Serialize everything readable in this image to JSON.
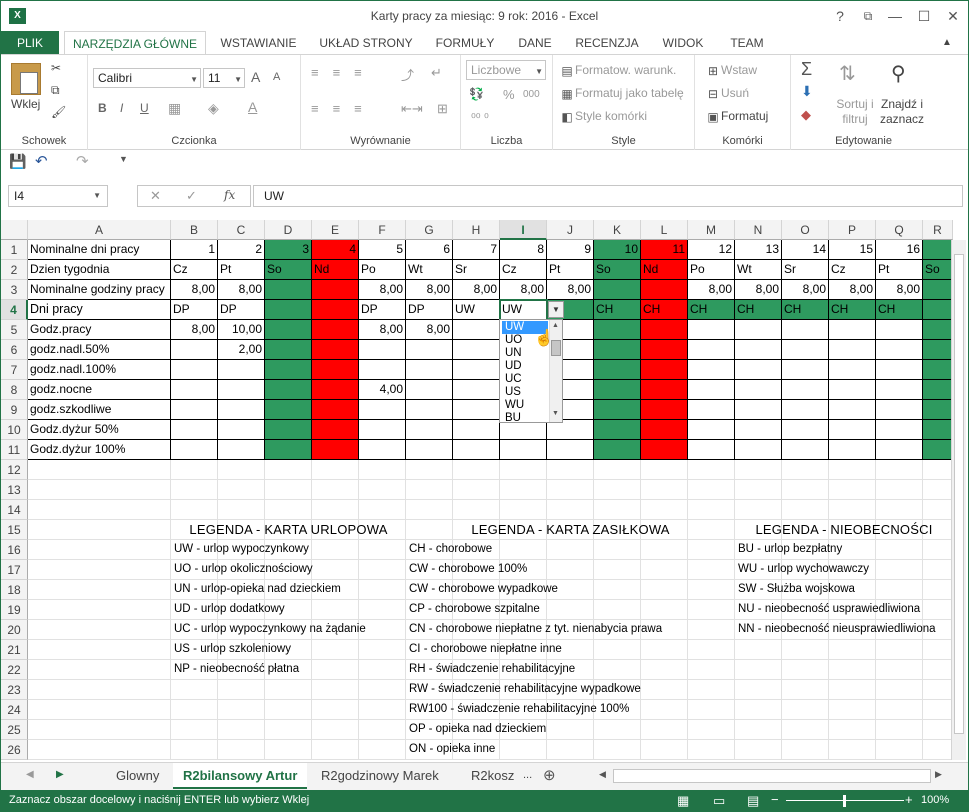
{
  "window": {
    "title": "Karty pracy za miesiąc: 9 rok: 2016 - Excel",
    "help": "?",
    "restore": "⧉",
    "minimize": "—",
    "maximize": "☐",
    "close": "✕"
  },
  "tabs": [
    "PLIK",
    "NARZĘDZIA GŁÓWNE",
    "WSTAWIANIE",
    "UKŁAD STRONY",
    "FORMUŁY",
    "DANE",
    "RECENZJA",
    "WIDOK",
    "TEAM"
  ],
  "ribbon": {
    "clipboard": {
      "label": "Schowek",
      "paste": "Wklej"
    },
    "font": {
      "label": "Czcionka",
      "name": "Calibri",
      "size": "11",
      "bold": "B",
      "italic": "I",
      "underline": "U",
      "grow": "A",
      "shrink": "A"
    },
    "alignment": {
      "label": "Wyrównanie"
    },
    "number": {
      "label": "Liczba",
      "format": "Liczbowe",
      "percent": "%",
      "comma": "000"
    },
    "styles": {
      "label": "Style",
      "conditional": "Formatow. warunk.",
      "table": "Formatuj jako tabelę",
      "cell_styles": "Style komórki"
    },
    "cells": {
      "label": "Komórki",
      "insert": "Wstaw",
      "delete": "Usuń",
      "format": "Formatuj"
    },
    "editing": {
      "label": "Edytowanie",
      "sort": "Sortuj i filtruj",
      "find": "Znajdź i zaznacz"
    }
  },
  "formula_bar": {
    "name_box": "I4",
    "fx": "fx",
    "value": "UW"
  },
  "columns": [
    "A",
    "B",
    "C",
    "D",
    "E",
    "F",
    "G",
    "H",
    "I",
    "J",
    "K",
    "L",
    "M",
    "N",
    "O",
    "P",
    "Q",
    "R"
  ],
  "rows": [
    "1",
    "2",
    "3",
    "4",
    "5",
    "6",
    "7",
    "8",
    "9",
    "10",
    "11",
    "12",
    "13",
    "14",
    "15",
    "16",
    "17",
    "18",
    "19",
    "20",
    "21",
    "22",
    "23",
    "24",
    "25",
    "26"
  ],
  "sheet": {
    "row1": {
      "label": "Nominalne dni pracy",
      "days": [
        "1",
        "2",
        "3",
        "4",
        "5",
        "6",
        "7",
        "8",
        "9",
        "10",
        "11",
        "12",
        "13",
        "14",
        "15",
        "16"
      ]
    },
    "row2": {
      "label": "Dzien tygodnia",
      "days": [
        "Cz",
        "Pt",
        "So",
        "Nd",
        "Po",
        "Wt",
        "Sr",
        "Cz",
        "Pt",
        "So",
        "Nd",
        "Po",
        "Wt",
        "Sr",
        "Cz",
        "Pt",
        "So"
      ]
    },
    "row3": {
      "label": "Nominalne godziny pracy",
      "hours": [
        "8,00",
        "8,00",
        "",
        "",
        "8,00",
        "8,00",
        "8,00",
        "8,00",
        "8,00",
        "",
        "",
        "8,00",
        "8,00",
        "8,00",
        "8,00",
        "8,00"
      ]
    },
    "row4": {
      "label": "Dni pracy",
      "vals": [
        "DP",
        "DP",
        "",
        "",
        "DP",
        "DP",
        "UW",
        "UW",
        "",
        "CH",
        "CH",
        "CH",
        "CH",
        "CH",
        "CH",
        "CH"
      ]
    },
    "row5": {
      "label": "Godz.pracy",
      "vals": [
        "8,00",
        "10,00",
        "",
        "",
        "8,00",
        "8,00"
      ]
    },
    "row6": {
      "label": "godz.nadl.50%",
      "c": "2,00"
    },
    "row7": {
      "label": "godz.nadl.100%"
    },
    "row8": {
      "label": "godz.nocne",
      "f": "4,00"
    },
    "row9": {
      "label": "godz.szkodliwe"
    },
    "row10": {
      "label": "Godz.dyżur 50%"
    },
    "row11": {
      "label": "Godz.dyżur 100%"
    }
  },
  "legend": {
    "urlop_title": "LEGENDA - KARTA URLOPOWA",
    "urlop": [
      "UW - urlop wypoczynkowy",
      "UO - urlop okolicznościowy",
      "UN - urlop-opieka nad dzieckiem",
      "UD - urlop dodatkowy",
      "UC - urlop wypoczynkowy na żądanie",
      "US - urlop szkoleniowy",
      "NP - nieobecność płatna"
    ],
    "zasilek_title": "LEGENDA - KARTA ZASIŁKOWA",
    "zasilek": [
      "CH - chorobowe",
      "CW - chorobowe 100%",
      "CW - chorobowe wypadkowe",
      "CP - chorobowe szpitalne",
      "CN - chorobowe niepłatne z tyt. nienabycia prawa",
      "CI - chorobowe niepłatne inne",
      "RH - świadczenie rehabilitacyjne",
      "RW - świadczenie rehabilitacyjne wypadkowe",
      "RW100 - świadczenie rehabilitacyjne 100%",
      "OP - opieka nad dzieckiem",
      "ON - opieka inne"
    ],
    "nieob_title": "LEGENDA - NIEOBECNOŚCI",
    "nieob": [
      "BU - urlop bezpłatny",
      "WU - urlop wychowawczy",
      "SW - Służba wojskowa",
      "NU - nieobecność usprawiedliwiona",
      "NN - nieobecność nieusprawiedliwiona"
    ]
  },
  "dropdown": {
    "options": [
      "UW",
      "UO",
      "UN",
      "UD",
      "UC",
      "US",
      "WU",
      "BU"
    ],
    "selected": "UW"
  },
  "sheet_tabs": [
    "Glowny",
    "R2bilansowy Artur",
    "R2godzinowy Marek",
    "R2kosz"
  ],
  "sheet_tabs_more": "...",
  "status": {
    "message": "Zaznacz obszar docelowy i naciśnij ENTER lub wybierz Wklej",
    "zoom": "100%"
  },
  "colors": {
    "accent": "#217346",
    "green_cell": "#2e9a5f",
    "red_cell": "#ff0000",
    "dropdown_sel": "#3399ff"
  }
}
